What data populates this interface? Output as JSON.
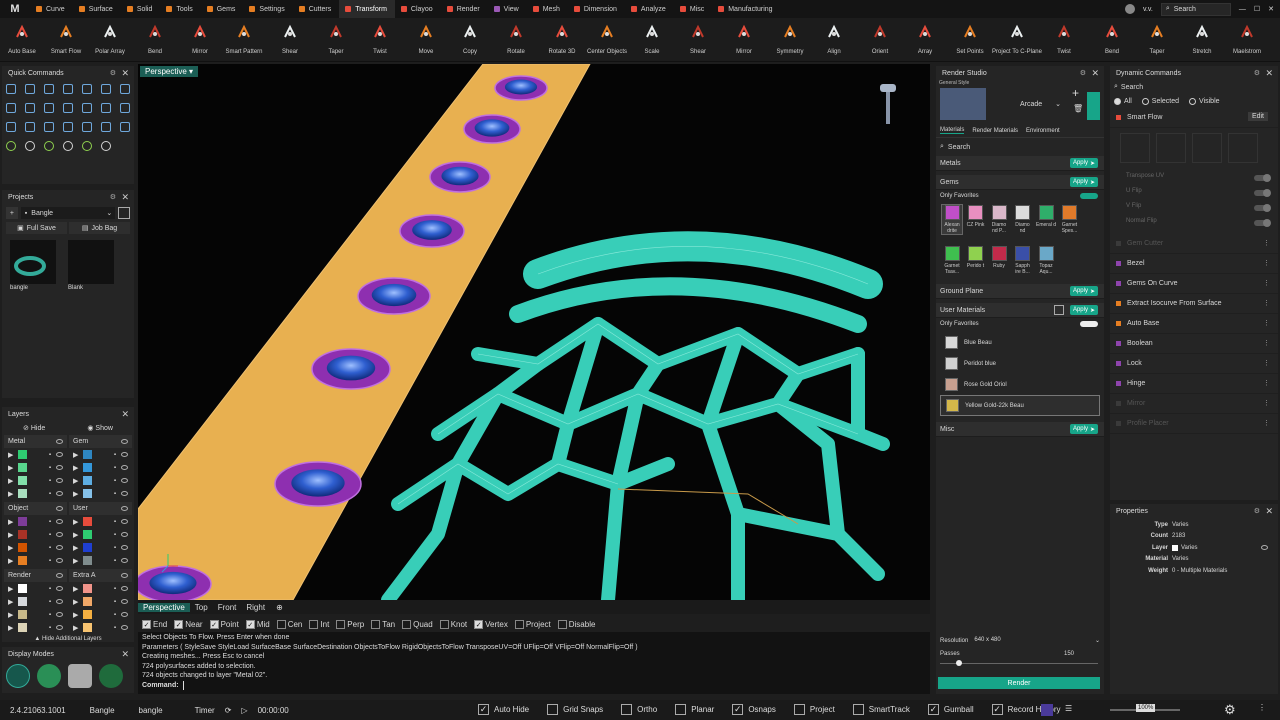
{
  "app": {
    "logo": "M",
    "user": "v.v."
  },
  "menu": [
    {
      "label": "Curve",
      "color": "#e67e22"
    },
    {
      "label": "Surface",
      "color": "#e67e22"
    },
    {
      "label": "Solid",
      "color": "#e67e22"
    },
    {
      "label": "Tools",
      "color": "#e67e22"
    },
    {
      "label": "Gems",
      "color": "#e67e22"
    },
    {
      "label": "Settings",
      "color": "#e67e22"
    },
    {
      "label": "Cutters",
      "color": "#e67e22"
    },
    {
      "label": "Transform",
      "color": "#e74c3c"
    },
    {
      "label": "Clayoo",
      "color": "#e74c3c"
    },
    {
      "label": "Render",
      "color": "#e74c3c"
    },
    {
      "label": "View",
      "color": "#9b59b6"
    },
    {
      "label": "Mesh",
      "color": "#e74c3c"
    },
    {
      "label": "Dimension",
      "color": "#e74c3c"
    },
    {
      "label": "Analyze",
      "color": "#e74c3c"
    },
    {
      "label": "Misc",
      "color": "#e74c3c"
    },
    {
      "label": "Manufacturing",
      "color": "#e74c3c"
    }
  ],
  "menu_search": "Search",
  "tools": [
    {
      "label": "Auto Base",
      "icon": "auto-base-icon"
    },
    {
      "label": "Smart Flow",
      "icon": "smart-flow-icon"
    },
    {
      "label": "Polar Array",
      "icon": "polar-array-icon"
    },
    {
      "label": "Bend",
      "icon": "bend-icon"
    },
    {
      "label": "Mirror",
      "icon": "mirror-icon"
    },
    {
      "label": "Smart Pattern",
      "icon": "smart-pattern-icon"
    },
    {
      "label": "Shear",
      "icon": "shear-icon"
    },
    {
      "label": "Taper",
      "icon": "taper-icon"
    },
    {
      "label": "Twist",
      "icon": "twist-icon"
    },
    {
      "label": "Move",
      "icon": "move-icon"
    },
    {
      "label": "Copy",
      "icon": "copy-icon"
    },
    {
      "label": "Rotate",
      "icon": "rotate-icon"
    },
    {
      "label": "Rotate 3D",
      "icon": "rotate-3d-icon"
    },
    {
      "label": "Center Objects",
      "icon": "center-objects-icon"
    },
    {
      "label": "Scale",
      "icon": "scale-icon"
    },
    {
      "label": "Shear",
      "icon": "shear-icon"
    },
    {
      "label": "Mirror",
      "icon": "mirror-icon"
    },
    {
      "label": "Symmetry",
      "icon": "symmetry-icon"
    },
    {
      "label": "Align",
      "icon": "align-icon"
    },
    {
      "label": "Orient",
      "icon": "orient-icon"
    },
    {
      "label": "Array",
      "icon": "array-icon"
    },
    {
      "label": "Set Points",
      "icon": "set-points-icon"
    },
    {
      "label": "Project To C-Plane",
      "icon": "project-cplane-icon"
    },
    {
      "label": "Twist",
      "icon": "twist-icon"
    },
    {
      "label": "Bend",
      "icon": "bend-icon"
    },
    {
      "label": "Taper",
      "icon": "taper-icon"
    },
    {
      "label": "Stretch",
      "icon": "stretch-icon"
    },
    {
      "label": "Maelstrom",
      "icon": "maelstrom-icon"
    }
  ],
  "quick_commands": {
    "title": "Quick Commands"
  },
  "projects": {
    "title": "Projects",
    "dropdown": "Bangle",
    "full_save": "Full Save",
    "job_bag": "Job Bag",
    "items": [
      "bangle",
      "Blank"
    ]
  },
  "layers": {
    "title": "Layers",
    "hide": "Hide",
    "show": "Show",
    "groups": [
      {
        "name": "Metal",
        "swatches": [
          "#2ecc71",
          "#58d68d",
          "#82e0aa",
          "#a9dfbf"
        ]
      },
      {
        "name": "Gem",
        "swatches": [
          "#2e86c1",
          "#3498db",
          "#5dade2",
          "#85c1e9"
        ]
      },
      {
        "name": "Object",
        "swatches": [
          "#7d3c98",
          "#a93226",
          "#d35400",
          "#e67e22"
        ]
      },
      {
        "name": "User",
        "swatches": [
          "#e74c3c",
          "#2ecc71",
          "#1f3fd1",
          "#7f8c8d"
        ]
      },
      {
        "name": "Render",
        "swatches": [
          "#ffffff",
          "#d5d8dc",
          "#c8b98a",
          "#dcd3b6"
        ]
      },
      {
        "name": "Extra A",
        "swatches": [
          "#f1948a",
          "#f0a868",
          "#f5b041",
          "#f8c471"
        ]
      }
    ],
    "more": "Hide Additional Layers"
  },
  "display_modes": {
    "title": "Display Modes"
  },
  "viewport": {
    "label": "Perspective",
    "tabs": [
      "Perspective",
      "Top",
      "Front",
      "Right"
    ],
    "snaps": [
      {
        "label": "End",
        "on": true
      },
      {
        "label": "Near",
        "on": true
      },
      {
        "label": "Point",
        "on": true
      },
      {
        "label": "Mid",
        "on": true
      },
      {
        "label": "Cen",
        "on": false
      },
      {
        "label": "Int",
        "on": false
      },
      {
        "label": "Perp",
        "on": false
      },
      {
        "label": "Tan",
        "on": false
      },
      {
        "label": "Quad",
        "on": false
      },
      {
        "label": "Knot",
        "on": false
      },
      {
        "label": "Vertex",
        "on": true
      },
      {
        "label": "Project",
        "on": false
      },
      {
        "label": "Disable",
        "on": false
      }
    ]
  },
  "command_log": [
    "Select Objects To Flow. Press Enter when done",
    "Parameters ( StyleSave  StyleLoad  SurfaceBase  SurfaceDestination  ObjectsToFlow  RigidObjectsToFlow  TransposeUV=Off  UFlip=Off  VFlip=Off  NormalFlip=Off )",
    "Creating meshes... Press Esc to cancel",
    "724 polysurfaces added to selection.",
    "724 objects changed to layer \"Metal 02\"."
  ],
  "command_prompt": "Command:",
  "render_studio": {
    "title": "Render Studio",
    "general_style": "General Style",
    "style": "Arcade",
    "tabs": [
      "Materials",
      "Render Materials",
      "Environment"
    ],
    "search": "Search",
    "sections": {
      "metals": "Metals",
      "gems": "Gems",
      "ground": "Ground Plane",
      "user": "User Materials",
      "misc": "Misc"
    },
    "apply": "Apply",
    "only_favorites": "Only Favorites",
    "gem_materials": [
      {
        "name": "Alexan drite",
        "color": "#c04fc8"
      },
      {
        "name": "CZ Pink",
        "color": "#e88fc0"
      },
      {
        "name": "Diamo nd P...",
        "color": "#d9b7c9"
      },
      {
        "name": "Diamo nd",
        "color": "#dcdcdc"
      },
      {
        "name": "Emeral d",
        "color": "#2fae6a"
      },
      {
        "name": "Garnet Spes...",
        "color": "#e07a2a"
      },
      {
        "name": "Garnet Tsav...",
        "color": "#3fbf4f"
      },
      {
        "name": "Perido t",
        "color": "#8fd14f"
      },
      {
        "name": "Ruby",
        "color": "#c22a4a"
      },
      {
        "name": "Sapph ire B...",
        "color": "#3a4fa8"
      },
      {
        "name": "Topaz Aqu...",
        "color": "#6aa8c8"
      }
    ],
    "user_materials": [
      {
        "name": "Blue Beau",
        "color": "#d8d8d8"
      },
      {
        "name": "Peridot blue",
        "color": "#d0d0d0"
      },
      {
        "name": "Rose Gold Oriol",
        "color": "#c8a090"
      },
      {
        "name": "Yellow Gold-22k Beau",
        "color": "#d4b84a"
      }
    ],
    "resolution_label": "Resolution",
    "resolution": "640 x 480",
    "passes_label": "Passes",
    "passes": "150",
    "passes_level": 0.1,
    "render_button": "Render"
  },
  "dynamic_commands": {
    "title": "Dynamic Commands",
    "search": "Search",
    "filters": [
      "All",
      "Selected",
      "Visible"
    ],
    "active": {
      "name": "Smart Flow",
      "edit": "Edit"
    },
    "options": [
      "Transpose UV",
      "U Flip",
      "V Flip",
      "Normal Flip"
    ],
    "commands": [
      {
        "name": "Gem Cutter",
        "enabled": false
      },
      {
        "name": "Bezel",
        "enabled": true
      },
      {
        "name": "Gems On Curve",
        "enabled": true
      },
      {
        "name": "Extract Isocurve From Surface",
        "enabled": true
      },
      {
        "name": "Auto Base",
        "enabled": true
      },
      {
        "name": "Boolean",
        "enabled": true
      },
      {
        "name": "Lock",
        "enabled": true
      },
      {
        "name": "Hinge",
        "enabled": true
      },
      {
        "name": "Mirror",
        "enabled": false
      },
      {
        "name": "Profile Placer",
        "enabled": false
      }
    ]
  },
  "properties": {
    "title": "Properties",
    "rows": [
      {
        "key": "Type",
        "value": "Varies"
      },
      {
        "key": "Count",
        "value": "2183"
      },
      {
        "key": "Layer",
        "value": "Varies"
      },
      {
        "key": "Material",
        "value": "Varies"
      },
      {
        "key": "Weight",
        "value": "0 - Multiple Materials"
      }
    ]
  },
  "status": {
    "version": "2.4.21063.1001",
    "project": "Bangle",
    "file": "bangle",
    "timer_label": "Timer",
    "timer": "00:00:00",
    "toggles": [
      {
        "label": "Auto Hide",
        "on": true
      },
      {
        "label": "Grid Snaps",
        "on": false
      },
      {
        "label": "Ortho",
        "on": false
      },
      {
        "label": "Planar",
        "on": false
      },
      {
        "label": "Osnaps",
        "on": true
      },
      {
        "label": "Project",
        "on": false
      },
      {
        "label": "SmartTrack",
        "on": false
      },
      {
        "label": "Gumball",
        "on": true
      },
      {
        "label": "Record History",
        "on": true
      }
    ],
    "zoom": "100%"
  },
  "colors": {
    "accent": "#17a589",
    "menu_active": "#2a2a2a",
    "mesh": "#3de0c8",
    "band": "#e8b050",
    "bezel": "#8e2fb0",
    "gem": "#2f5fd0"
  }
}
